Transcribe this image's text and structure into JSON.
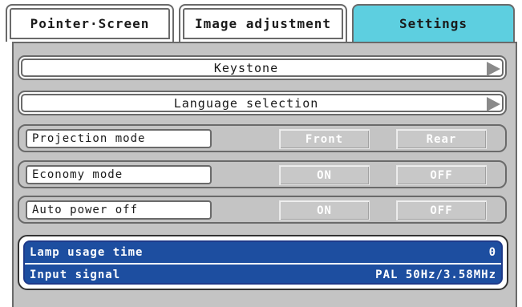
{
  "tabs": [
    {
      "label": "Pointer·Screen",
      "active": false
    },
    {
      "label": "Image adjustment",
      "active": false
    },
    {
      "label": "Settings",
      "active": true
    }
  ],
  "menu": {
    "keystone": "Keystone",
    "language": "Language selection"
  },
  "options": [
    {
      "label": "Projection mode",
      "choices": [
        "Front",
        "Rear"
      ]
    },
    {
      "label": "Economy mode",
      "choices": [
        "ON",
        "OFF"
      ]
    },
    {
      "label": "Auto power off",
      "choices": [
        "ON",
        "OFF"
      ]
    }
  ],
  "info": {
    "lamp_label": "Lamp usage time",
    "lamp_value": "0",
    "signal_label": "Input signal",
    "signal_value": "PAL 50Hz/3.58MHz"
  },
  "colors": {
    "active_tab": "#5dcfe0",
    "panel_bg": "#c4c4c4",
    "info_bg": "#1d4ea0"
  },
  "icons": [
    "arrow-right-icon"
  ]
}
